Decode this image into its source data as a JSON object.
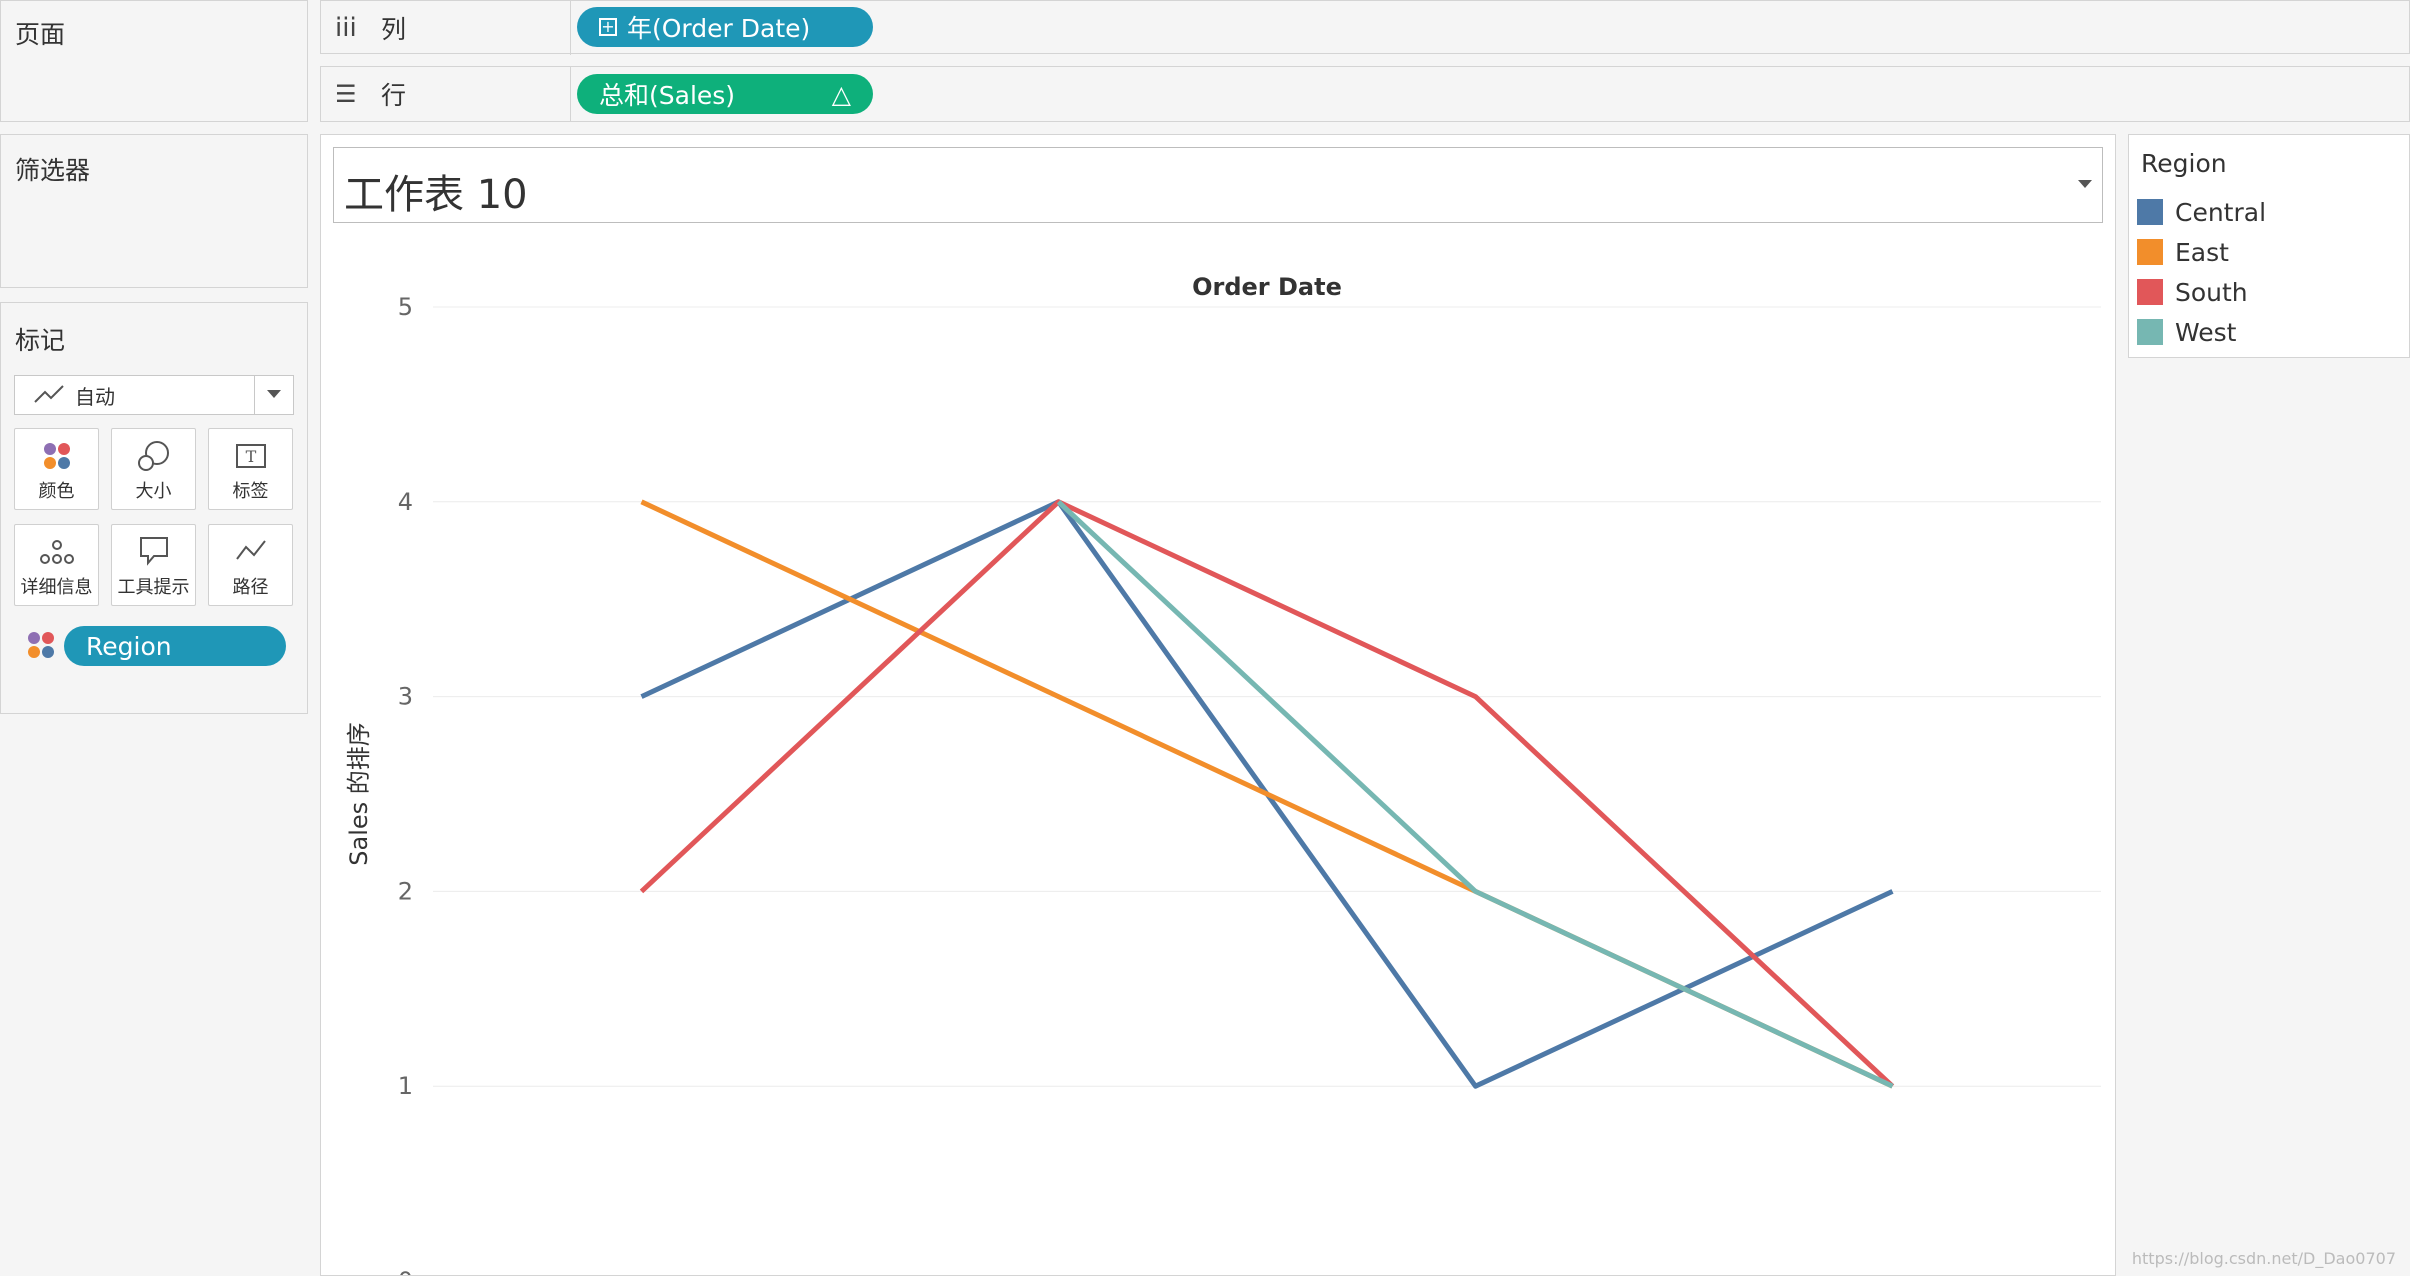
{
  "pages_panel": {
    "title": "页面"
  },
  "filters_panel": {
    "title": "筛选器"
  },
  "marks_panel": {
    "title": "标记",
    "mark_type": "自动",
    "buttons": [
      {
        "label": "颜色",
        "icon": "color-icon"
      },
      {
        "label": "大小",
        "icon": "size-icon"
      },
      {
        "label": "标签",
        "icon": "label-icon"
      },
      {
        "label": "详细信息",
        "icon": "detail-icon"
      },
      {
        "label": "工具提示",
        "icon": "tooltip-icon"
      },
      {
        "label": "路径",
        "icon": "path-icon"
      }
    ],
    "color_pill": "Region"
  },
  "columns_shelf": {
    "label": "列",
    "pill": "年(Order Date)"
  },
  "rows_shelf": {
    "label": "行",
    "pill": "总和(Sales)",
    "pill_icon": "△"
  },
  "worksheet": {
    "title": "工作表 10"
  },
  "legend": {
    "title": "Region",
    "items": [
      {
        "label": "Central",
        "color": "#4e79a7"
      },
      {
        "label": "East",
        "color": "#f28e2b"
      },
      {
        "label": "South",
        "color": "#e15759"
      },
      {
        "label": "West",
        "color": "#76b7b2"
      }
    ]
  },
  "chart_data": {
    "type": "line",
    "xlabel": "Order Date",
    "ylabel": "Sales 的排序",
    "ylim": [
      0,
      5
    ],
    "yticks": [
      "0",
      "1",
      "2",
      "3",
      "4",
      "5"
    ],
    "x": [
      1,
      2,
      3,
      4
    ],
    "series": [
      {
        "name": "Central",
        "color": "#4e79a7",
        "values": [
          3,
          4,
          1,
          2
        ]
      },
      {
        "name": "East",
        "color": "#f28e2b",
        "values": [
          4,
          3,
          2,
          1
        ]
      },
      {
        "name": "South",
        "color": "#e15759",
        "values": [
          2,
          4,
          3,
          1
        ]
      },
      {
        "name": "West",
        "color": "#76b7b2",
        "values": [
          null,
          4,
          2,
          1
        ]
      }
    ]
  },
  "watermark": "https://blog.csdn.net/D_Dao0707"
}
